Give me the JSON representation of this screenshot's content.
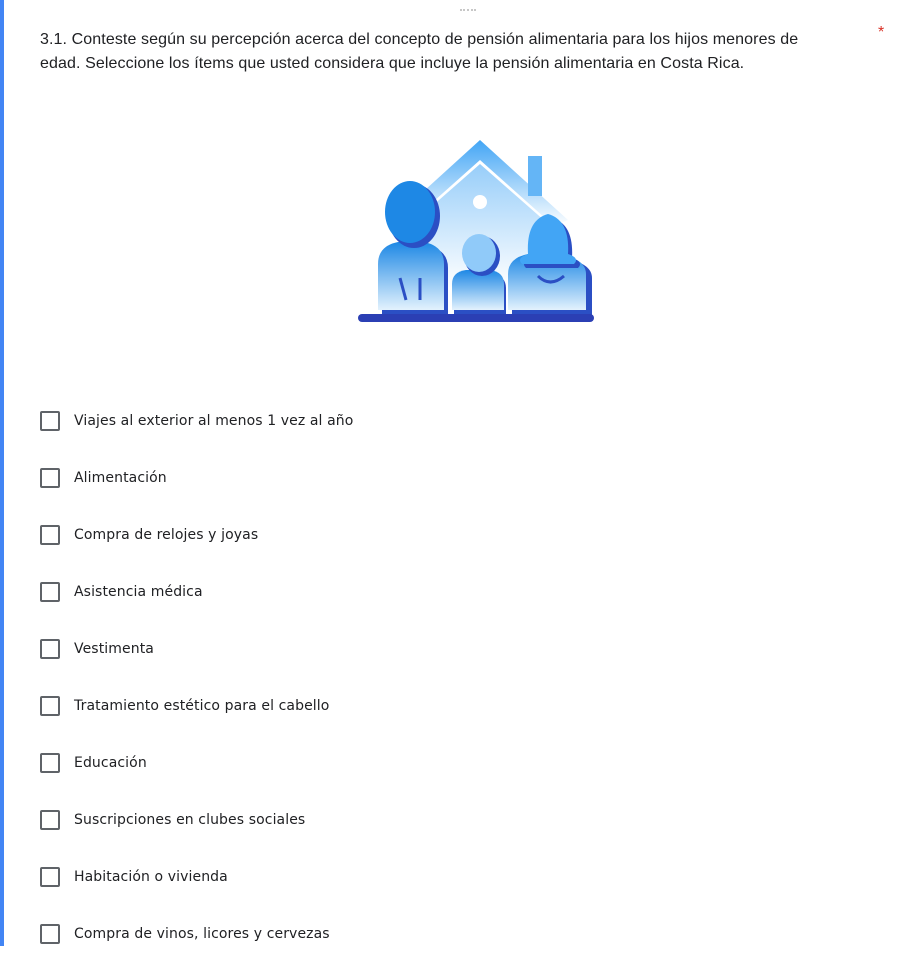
{
  "question": {
    "title": "3.1. Conteste según su percepción acerca del concepto de pensión alimentaria para los hijos menores de edad. Seleccione los ítems que usted considera que incluye la pensión alimentaria en Costa Rica.",
    "required_marker": "*",
    "image_icon": "family-house-icon"
  },
  "options": [
    {
      "label": "Viajes al exterior al menos 1 vez al año",
      "checked": false
    },
    {
      "label": "Alimentación",
      "checked": false
    },
    {
      "label": "Compra de relojes y joyas",
      "checked": false
    },
    {
      "label": "Asistencia médica",
      "checked": false
    },
    {
      "label": "Vestimenta",
      "checked": false
    },
    {
      "label": "Tratamiento estético para el cabello",
      "checked": false
    },
    {
      "label": "Educación",
      "checked": false
    },
    {
      "label": "Suscripciones en clubes sociales",
      "checked": false
    },
    {
      "label": "Habitación o vivienda",
      "checked": false
    },
    {
      "label": "Compra de vinos, licores y cervezas",
      "checked": false
    }
  ],
  "colors": {
    "accent": "#4285f4",
    "required": "#d93025",
    "illustration_dark": "#2b4fc4",
    "illustration_light": "#42a5f5"
  }
}
